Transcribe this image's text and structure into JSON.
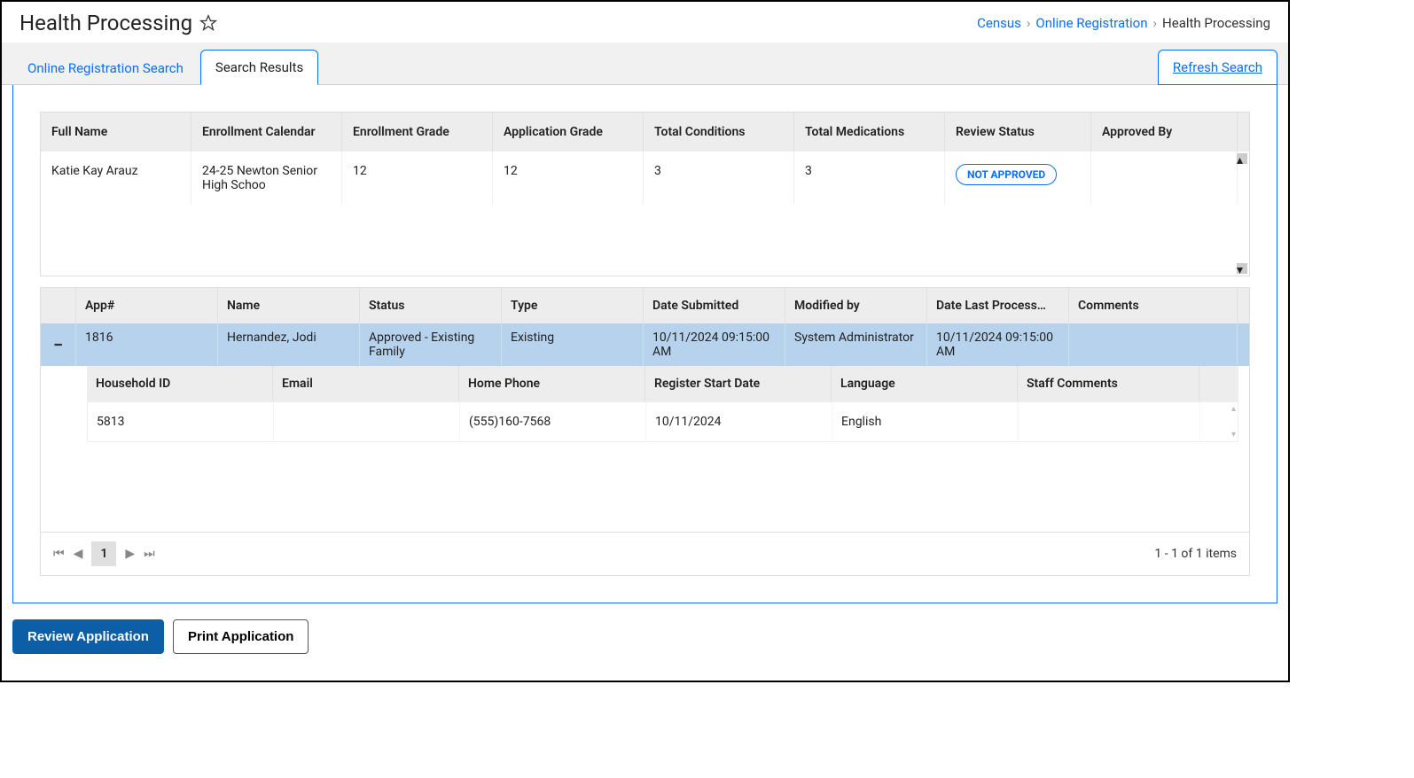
{
  "header": {
    "title": "Health Processing",
    "breadcrumb": {
      "census": "Census",
      "olr": "Online Registration",
      "current": "Health Processing"
    }
  },
  "tabs": {
    "search": "Online Registration Search",
    "results": "Search Results",
    "refresh": "Refresh Search"
  },
  "grid1": {
    "headers": {
      "full_name": "Full Name",
      "enroll_cal": "Enrollment Calendar",
      "enroll_grade": "Enrollment Grade",
      "app_grade": "Application Grade",
      "total_cond": "Total Conditions",
      "total_meds": "Total Medications",
      "review_status": "Review Status",
      "approved_by": "Approved By"
    },
    "rows": [
      {
        "full_name": "Katie Kay Arauz",
        "enroll_cal": "24-25 Newton Senior High Schoo",
        "enroll_grade": "12",
        "app_grade": "12",
        "total_cond": "3",
        "total_meds": "3",
        "review_status": "NOT APPROVED",
        "approved_by": ""
      }
    ]
  },
  "grid2": {
    "headers": {
      "app_no": "App#",
      "name": "Name",
      "status": "Status",
      "type": "Type",
      "date_submitted": "Date Submitted",
      "modified_by": "Modified by",
      "date_last": "Date Last Process…",
      "comments": "Comments"
    },
    "rows": [
      {
        "app_no": "1816",
        "name": "Hernandez, Jodi",
        "status": "Approved - Existing Family",
        "type": "Existing",
        "date_submitted": "10/11/2024 09:15:00 AM",
        "modified_by": "System Administrator",
        "date_last": "10/11/2024 09:15:00 AM",
        "comments": ""
      }
    ],
    "sub_headers": {
      "household_id": "Household ID",
      "email": "Email",
      "home_phone": "Home Phone",
      "reg_start": "Register Start Date",
      "language": "Language",
      "staff_comments": "Staff Comments"
    },
    "sub_rows": [
      {
        "household_id": "5813",
        "email": "",
        "home_phone": "(555)160-7568",
        "reg_start": "10/11/2024",
        "language": "English",
        "staff_comments": ""
      }
    ]
  },
  "pager": {
    "page": "1",
    "info": "1 - 1 of 1 items"
  },
  "actions": {
    "review": "Review Application",
    "print": "Print Application"
  }
}
